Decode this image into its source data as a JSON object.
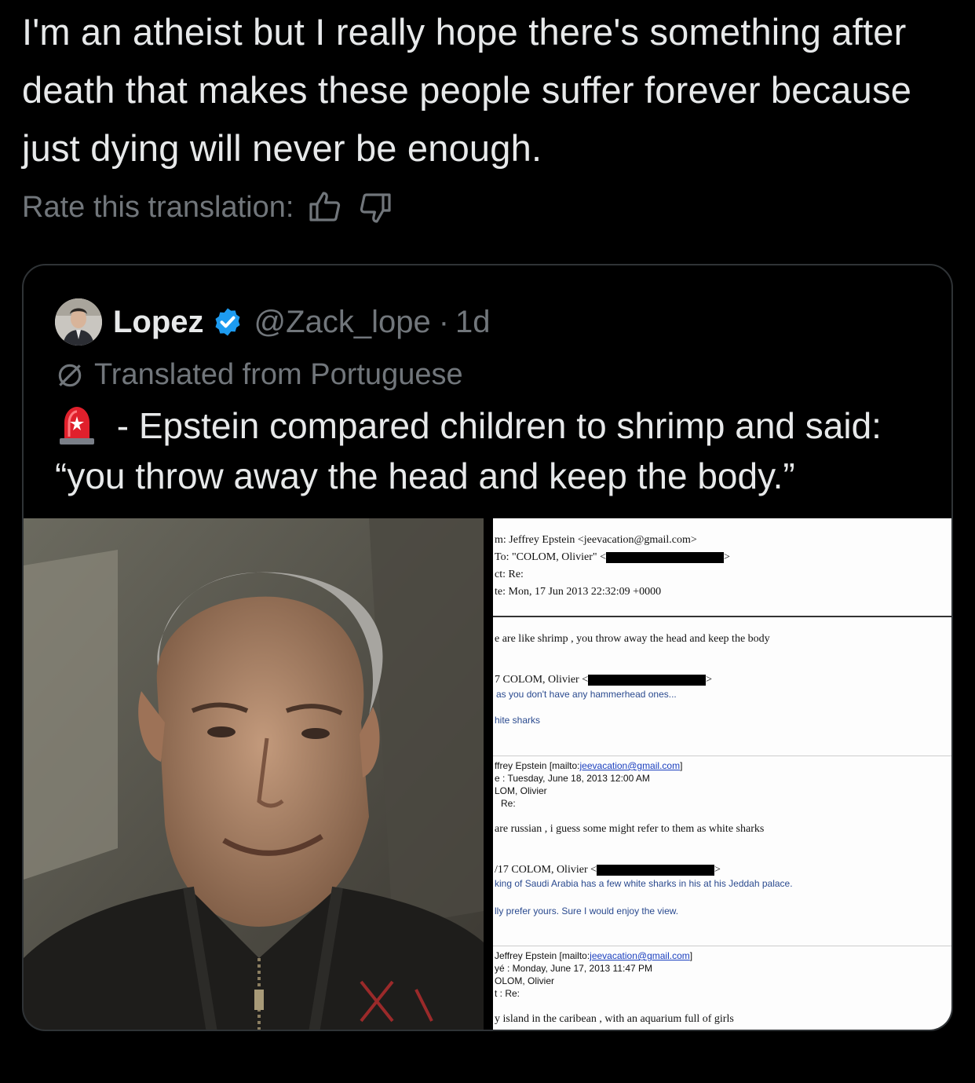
{
  "tweet": {
    "text": "I'm an atheist but I really hope there's something after death that makes these people suffer forever because just dying will never be enough.",
    "rate_label": "Rate this translation:",
    "thumbs_up_icon": "thumbs-up-icon",
    "thumbs_down_icon": "thumbs-down-icon"
  },
  "quote": {
    "name": "Lopez",
    "handle": "@Zack_lope",
    "separator": "·",
    "time": "1d",
    "translated_label": "Translated from Portuguese",
    "text_after_emoji": " - Epstein compared children to shrimp and said: “you throw away the head and keep the body.”"
  },
  "document": {
    "header": {
      "from": "m: Jeffrey Epstein <jeevacation@gmail.com>",
      "to_prefix": "To: \"COLOM, Olivier\" <",
      "to_suffix": ">",
      "subject": "ct: Re:",
      "date": "te: Mon, 17 Jun 2013 22:32:09 +0000"
    },
    "body1": "e are like shrimp , you throw away the head and keep the body",
    "q1_prefix": "7 COLOM, Olivier <",
    "q1_suffix": ">",
    "q1_line": "as you don't have any hammerhead ones...",
    "q1_line2": "hite sharks",
    "q2_from_prefix": "ffrey Epstein [mailto:",
    "q2_from_link": "jeevacation@gmail.com",
    "q2_from_suffix": "]",
    "q2_date": "e : Tuesday, June 18, 2013 12:00 AM",
    "q2_to": "LOM, Olivier",
    "q2_subject": "Re:",
    "body2": "are russian , i guess some might refer to them as white sharks",
    "q3_prefix": "/17 COLOM, Olivier <",
    "q3_suffix": ">",
    "q3_line": "king of Saudi Arabia has a few white sharks in his at his Jeddah palace.",
    "q3_line2": "lly prefer yours. Sure I would enjoy the view.",
    "q4_from_prefix": "Jeffrey Epstein [mailto:",
    "q4_from_link": "jeevacation@gmail.com",
    "q4_from_suffix": "]",
    "q4_date": "yé : Monday, June 17, 2013 11:47 PM",
    "q4_to": "OLOM, Olivier",
    "q4_subject": "t : Re:",
    "body3": "y island in the caribean , with an aquarium full of girls"
  },
  "colors": {
    "background": "#000000",
    "text": "#e7e9ea",
    "muted": "#71767b",
    "verified": "#1d9bf0",
    "border": "#2f3336"
  }
}
